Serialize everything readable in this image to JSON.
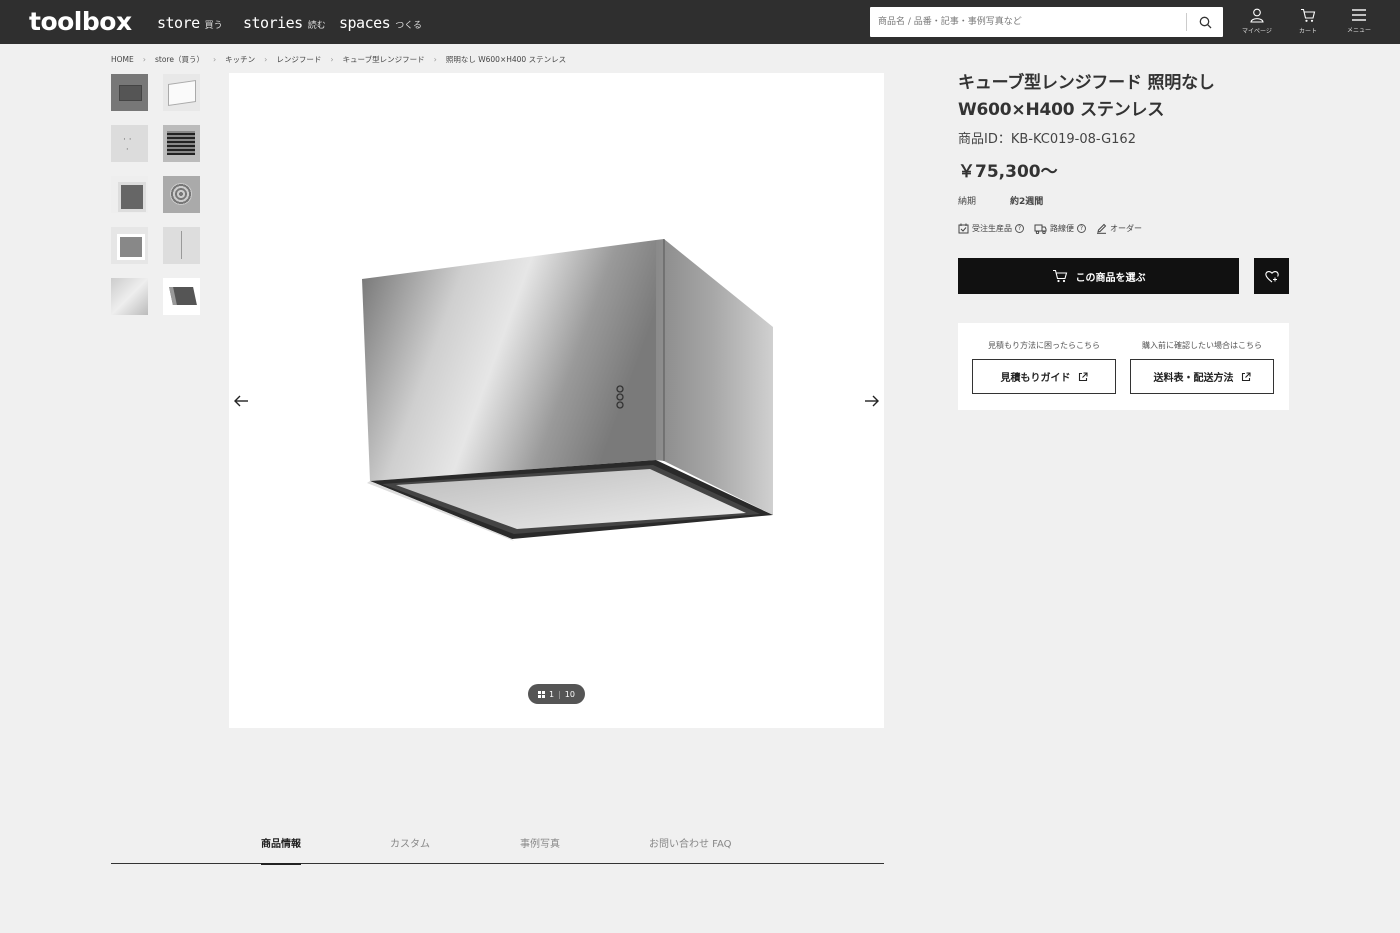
{
  "header": {
    "logo": "toolbox",
    "nav": [
      {
        "main": "store",
        "sub": "買う"
      },
      {
        "main": "stories",
        "sub": "読む"
      },
      {
        "main": "spaces",
        "sub": "つくる"
      }
    ],
    "search_placeholder": "商品名 / 品番・記事・事例写真など",
    "icons": [
      {
        "icon": "user-icon",
        "label": "マイページ"
      },
      {
        "icon": "cart-icon",
        "label": "カート"
      },
      {
        "icon": "menu-icon",
        "label": "メニュー"
      }
    ]
  },
  "breadcrumb": [
    "HOME",
    "store（買う）",
    "キッチン",
    "レンジフード",
    "キューブ型レンジフード",
    "照明なし W600×H400 ステンレス"
  ],
  "gallery": {
    "counter_current": "1",
    "counter_total": "10",
    "thumbnail_count": 10
  },
  "product": {
    "title_line1": "キューブ型レンジフード 照明なし",
    "title_line2": "W600×H400 ステンレス",
    "product_id": "商品ID：KB-KC019-08-G162",
    "price": "￥75,300〜",
    "delivery_label": "納期",
    "delivery_value": "約2週間",
    "tags": [
      {
        "icon": "order-calendar-icon",
        "label": "受注生産品",
        "help": true
      },
      {
        "icon": "truck-icon",
        "label": "路線便",
        "help": true
      },
      {
        "icon": "pen-icon",
        "label": "オーダー",
        "help": false
      }
    ],
    "buy_label": "この商品を選ぶ",
    "help": [
      {
        "note": "見積もり方法に困ったらこちら",
        "button": "見積もりガイド"
      },
      {
        "note": "購入前に確認したい場合はこちら",
        "button": "送料表・配送方法"
      }
    ]
  },
  "tabs": [
    {
      "label": "商品情報",
      "active": true
    },
    {
      "label": "カスタム",
      "active": false
    },
    {
      "label": "事例写真",
      "active": false
    },
    {
      "label": "お問い合わせ FAQ",
      "active": false
    }
  ]
}
